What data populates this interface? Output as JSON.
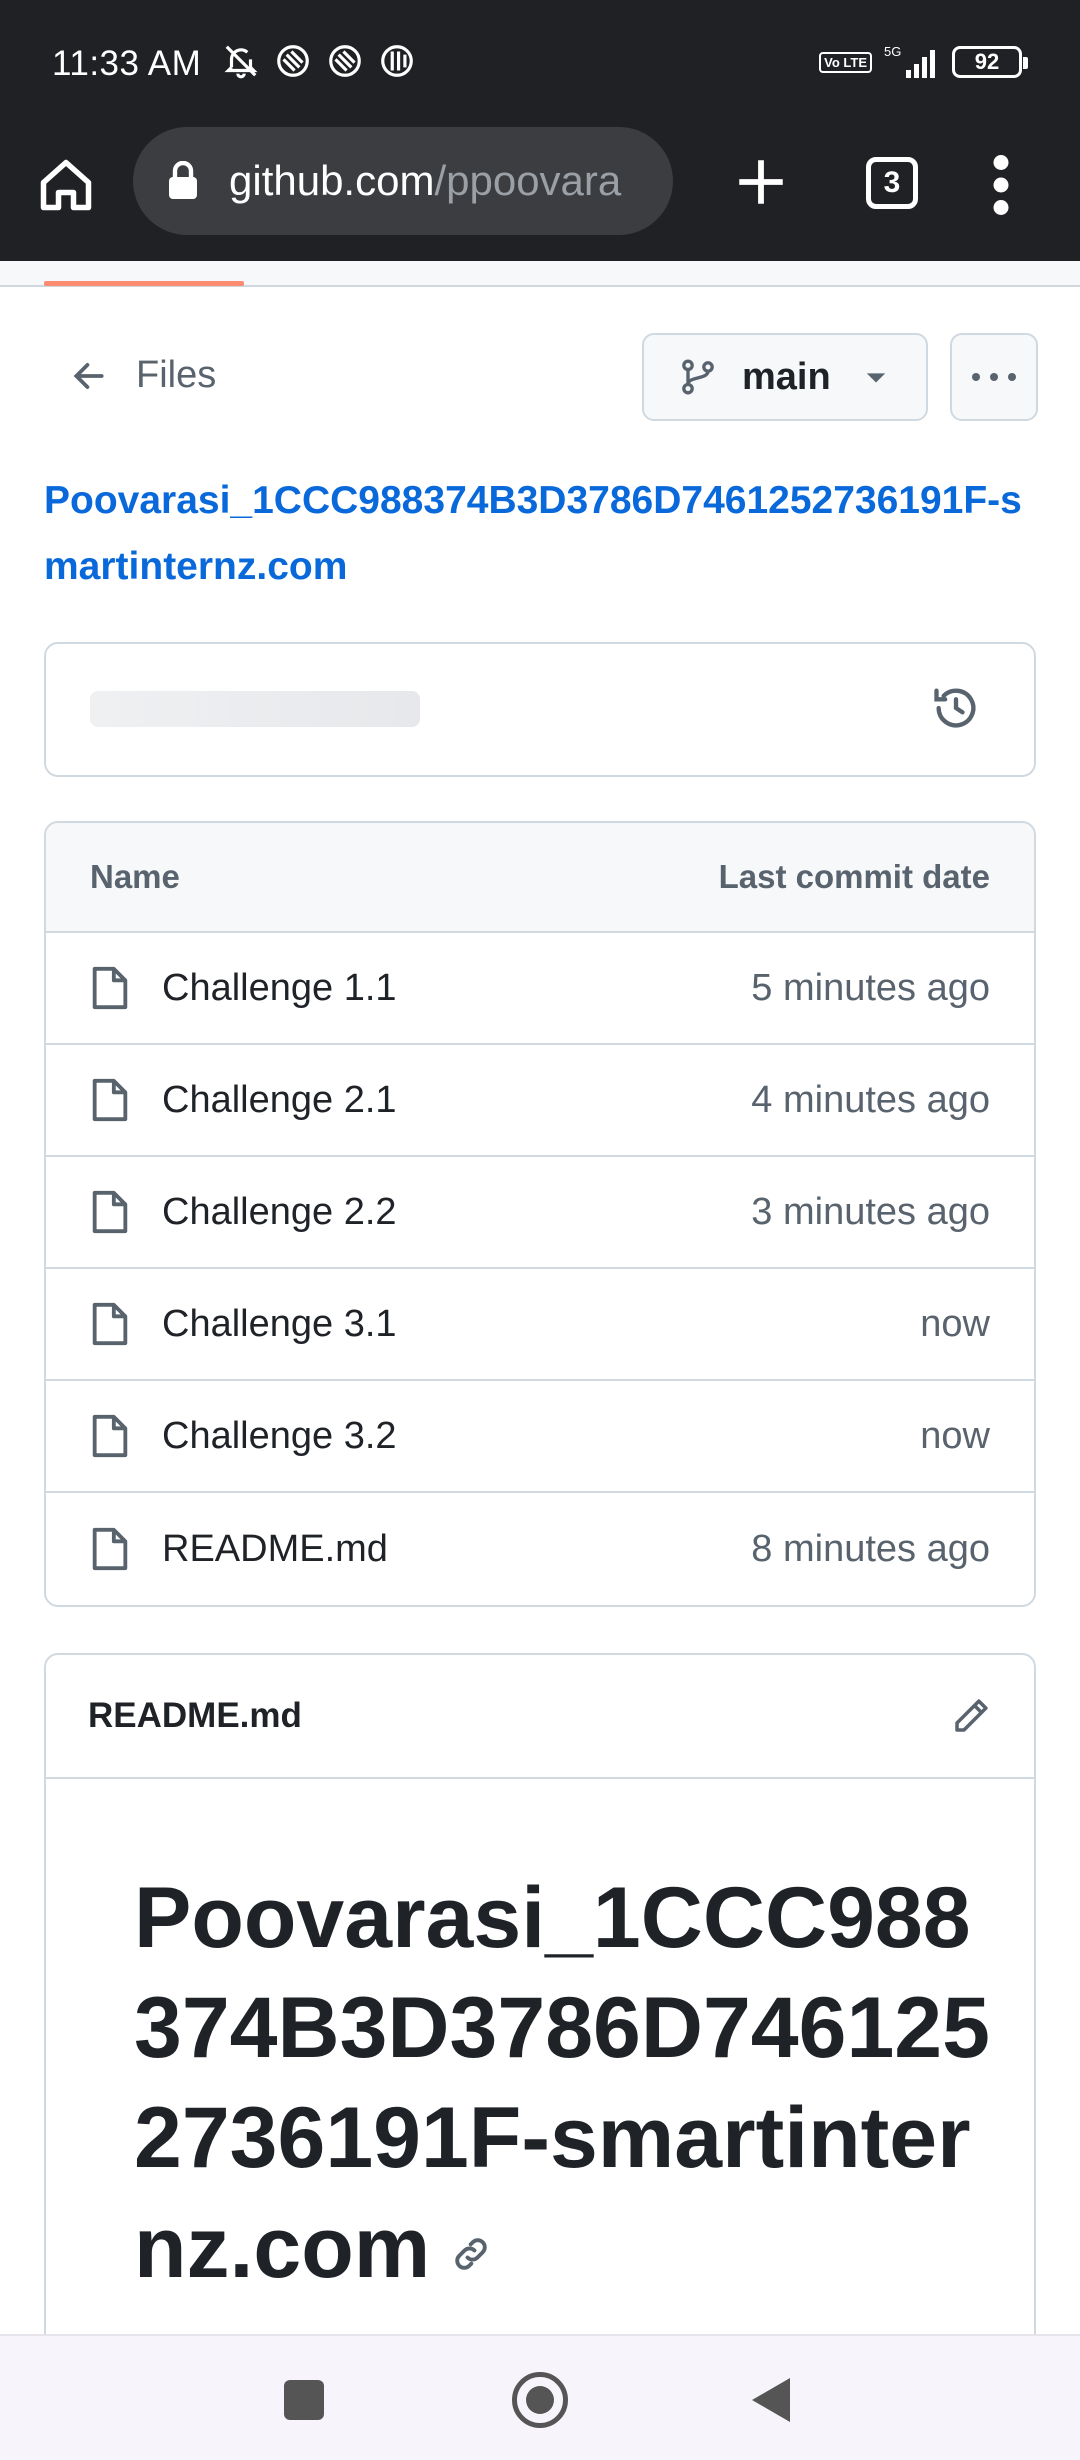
{
  "status_bar": {
    "time": "11:33 AM",
    "network": "5G",
    "volte": "Vo LTE",
    "battery": "92"
  },
  "browser": {
    "url_host": "github.com",
    "url_path": "/ppoovara",
    "tab_count": "3"
  },
  "nav": {
    "back_label": "Files",
    "branch": "main"
  },
  "repo": {
    "title": "Poovarasi_1CCC988374B3D3786D7461252736191F-smartinternz.com"
  },
  "file_table": {
    "headers": {
      "name": "Name",
      "date": "Last commit date"
    },
    "rows": [
      {
        "name": "Challenge 1.1",
        "date": "5 minutes ago"
      },
      {
        "name": "Challenge 2.1",
        "date": "4 minutes ago"
      },
      {
        "name": "Challenge 2.2",
        "date": "3 minutes ago"
      },
      {
        "name": "Challenge 3.1",
        "date": "now"
      },
      {
        "name": "Challenge 3.2",
        "date": "now"
      },
      {
        "name": "README.md",
        "date": "8 minutes ago"
      }
    ]
  },
  "readme": {
    "filename": "README.md",
    "heading": "Poovarasi_1CCC988374B3D3786D7461252736191F-smartinternz.com"
  },
  "colors": {
    "link": "#0969da",
    "accent_loading": "#fd8c73",
    "chrome_bg": "#202124"
  },
  "icons": [
    "home-icon",
    "lock-icon",
    "plus-icon",
    "tabs-icon",
    "menu-icon",
    "arrow-left-icon",
    "git-branch-icon",
    "triangle-down-icon",
    "kebab-icon",
    "history-icon",
    "file-icon",
    "pencil-icon",
    "link-icon"
  ]
}
